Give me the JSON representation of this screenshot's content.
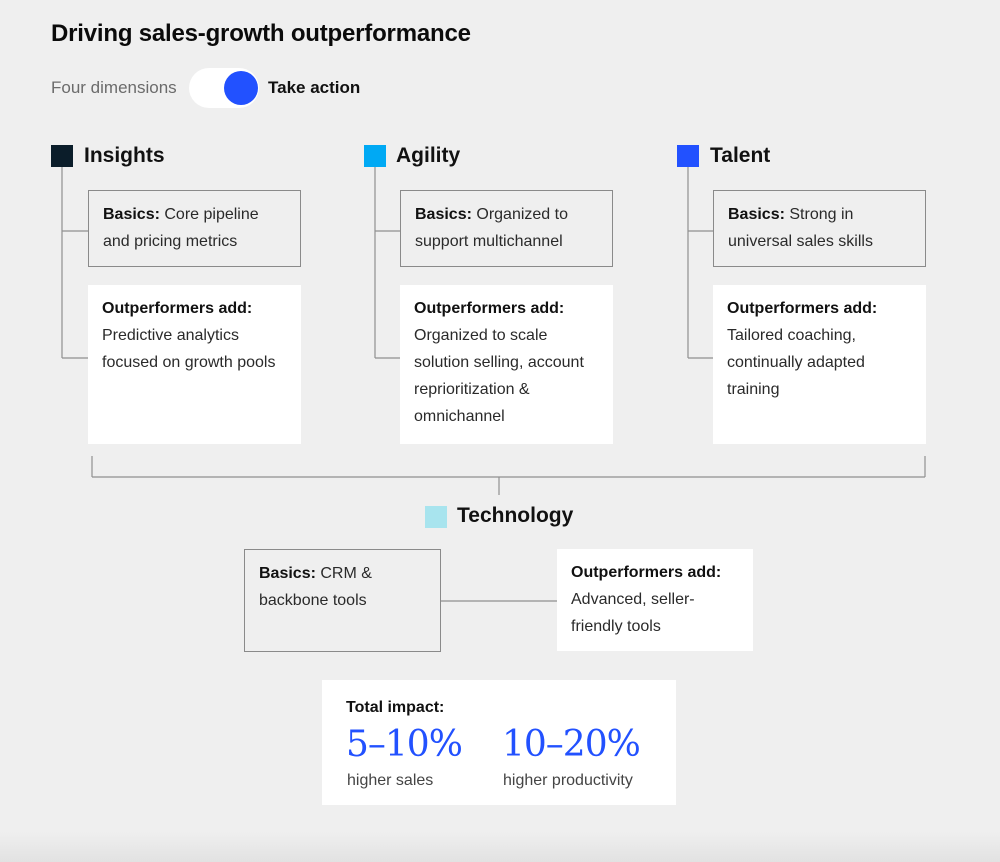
{
  "title": "Driving sales-growth outperformance",
  "toggle": {
    "left_label": "Four dimensions",
    "right_label": "Take action",
    "state": "on",
    "knob_color": "#2251ff"
  },
  "columns": [
    {
      "name": "Insights",
      "color": "#0b1d2a",
      "basics_label": "Basics:",
      "basics_text": " Core pipeline and pricing metrics",
      "outperformers_label": "Outperformers add:",
      "outperformers_text": "Predictive analytics focused on growth pools"
    },
    {
      "name": "Agility",
      "color": "#00a9f4",
      "basics_label": "Basics:",
      "basics_text": " Organized to support multichannel",
      "outperformers_label": "Outperformers add:",
      "outperformers_text": "Organized to scale solution selling, account reprioritization & omnichannel"
    },
    {
      "name": "Talent",
      "color": "#2251ff",
      "basics_label": "Basics:",
      "basics_text": " Strong in universal sales skills",
      "outperformers_label": "Outperformers add:",
      "outperformers_text": "Tailored coaching, continually adapted training"
    }
  ],
  "technology": {
    "name": "Technology",
    "color": "#a8e4ee",
    "basics_label": "Basics:",
    "basics_text": " CRM & backbone tools",
    "outperformers_label": "Outperformers add:",
    "outperformers_text": "Advanced, seller-friendly tools"
  },
  "impact": {
    "label": "Total impact:",
    "sales_value": "5–10%",
    "sales_caption": "higher sales",
    "productivity_value": "10–20%",
    "productivity_caption": "higher productivity",
    "value_color": "#2251ff"
  }
}
